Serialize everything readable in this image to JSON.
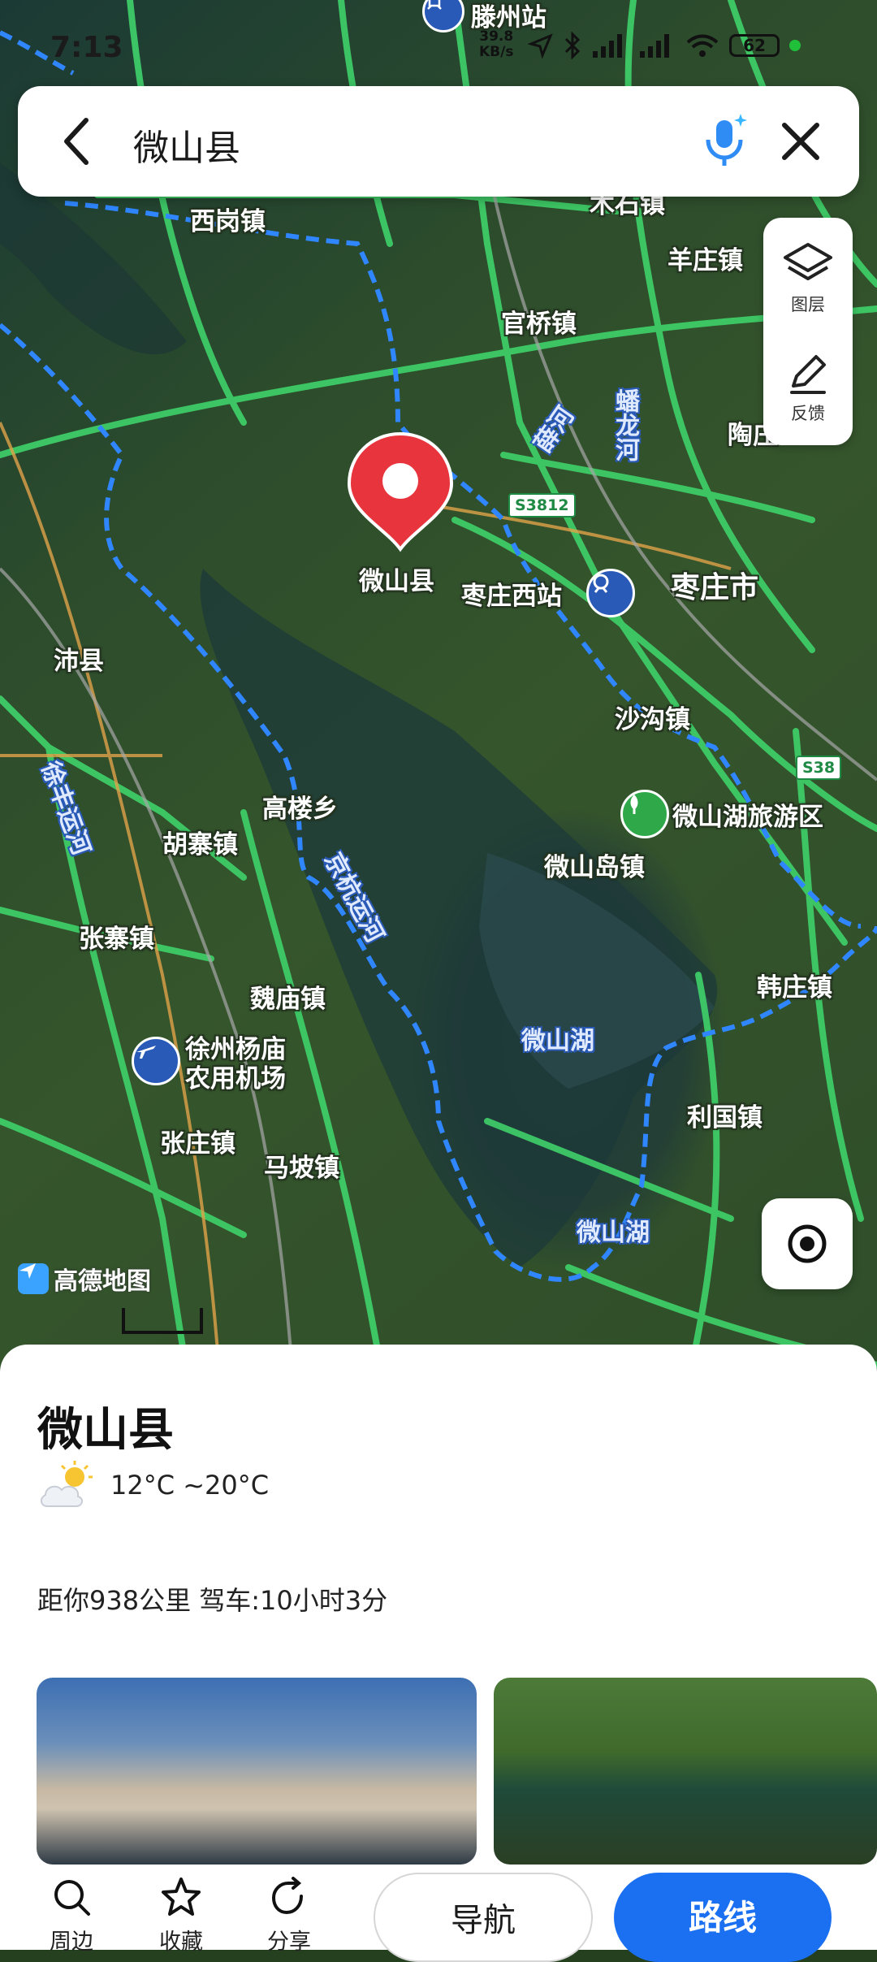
{
  "status_bar": {
    "time": "7:13",
    "net_speed_value": "39.8",
    "net_speed_unit": "KB/s",
    "battery": "62"
  },
  "search": {
    "query": "微山县"
  },
  "map_controls": {
    "layers_label": "图层",
    "feedback_label": "反馈"
  },
  "map_labels": {
    "station_top": "滕州站",
    "town_top_right": "木石镇",
    "xigang": "西岗镇",
    "yangzhuang": "羊庄镇",
    "guanqiao": "官桥镇",
    "xuehe": "薛河",
    "panlonghe": "蟠龙河",
    "taozhuang": "陶庄",
    "route_s3812": "S3812",
    "pin_label": "微山县",
    "zaozhuang_west": "枣庄西站",
    "zaozhuang_city": "枣庄市",
    "peixian": "沛县",
    "shagou": "沙沟镇",
    "route_s38": "S38",
    "xufeng_canal": "徐丰运河",
    "gaolou": "高楼乡",
    "scenic": "微山湖旅游区",
    "huzhai": "胡寨镇",
    "weishandao": "微山岛镇",
    "jingbei_canal": "京杭运河",
    "zhangzhai": "张寨镇",
    "weimiao": "魏庙镇",
    "hanzhuang": "韩庄镇",
    "lake_1": "微山湖",
    "airport_line1": "徐州杨庙",
    "airport_line2": "农用机场",
    "liguo": "利国镇",
    "zhangzhuang": "张庄镇",
    "mapo": "马坡镇",
    "lake_2": "微山湖",
    "watermark": "高德地图"
  },
  "place": {
    "name": "微山县",
    "temperature": "12°C ~20°C",
    "distance": "距你938公里 驾车:10小时3分"
  },
  "bottom_bar": {
    "nearby": "周边",
    "favorite": "收藏",
    "share": "分享",
    "navigate": "导航",
    "route": "路线"
  },
  "colors": {
    "accent": "#1b70f2",
    "pin": "#e8343c",
    "road": "#3fd26a",
    "boundary": "#2f86ff"
  }
}
